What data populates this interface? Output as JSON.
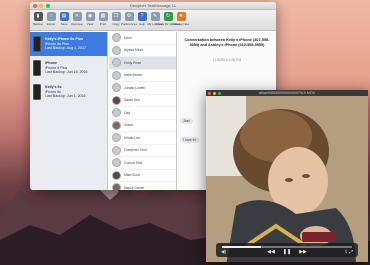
{
  "app": {
    "title": "Decipher TextMessage 11",
    "toolbar": [
      {
        "label": "Backup",
        "icon": "phone-backup-icon",
        "glyph": "▮",
        "tone": "dark"
      },
      {
        "label": "Export",
        "icon": "export-icon",
        "glyph": "↑",
        "tone": ""
      },
      {
        "label": "Save",
        "icon": "save-icon",
        "glyph": "▤",
        "tone": "blue"
      },
      {
        "label": "Remove",
        "icon": "remove-icon",
        "glyph": "✕",
        "tone": ""
      },
      {
        "label": "View",
        "icon": "view-icon",
        "glyph": "◉",
        "tone": ""
      },
      {
        "label": "Print",
        "icon": "print-icon",
        "glyph": "▦",
        "tone": ""
      },
      {
        "label": "Copy",
        "icon": "copy-icon",
        "glyph": "❐",
        "tone": ""
      },
      {
        "label": "Preferences",
        "icon": "preferences-icon",
        "glyph": "⚙",
        "tone": ""
      },
      {
        "label": "Help",
        "icon": "help-icon",
        "glyph": "?",
        "tone": "blue"
      },
      {
        "label": "My License",
        "icon": "license-icon",
        "glyph": "✎",
        "tone": ""
      },
      {
        "label": "Check for Updates",
        "icon": "updates-icon",
        "glyph": "↻",
        "tone": "green"
      },
      {
        "label": "Review Now",
        "icon": "review-icon",
        "glyph": "★",
        "tone": "orange"
      }
    ],
    "devices": [
      {
        "lines": [
          "Kelly's iPhone 8s Plus",
          "iPhone 8s Plus",
          "Last Backup: Aug 1, 2017"
        ],
        "selected": true
      },
      {
        "lines": [
          "iPhone",
          "iPhone 8 Plus",
          "Last Backup: Jun 15, 2016"
        ],
        "selected": false
      },
      {
        "lines": [
          "Kelly's 6s",
          "iPhone 6s",
          "Last Backup: Jun 1, 2016"
        ],
        "selected": false
      }
    ],
    "contacts": [
      {
        "name": "Mom",
        "avatar": ""
      },
      {
        "name": "Alyssa Miner",
        "avatar": ""
      },
      {
        "name": "Emily Rose",
        "avatar": "",
        "selected": true
      },
      {
        "name": "Katie Brown",
        "avatar": ""
      },
      {
        "name": "Jordan Lowell",
        "avatar": ""
      },
      {
        "name": "Sarah Kim",
        "avatar": "b"
      },
      {
        "name": "Dad",
        "avatar": ""
      },
      {
        "name": "Grace",
        "avatar": "p"
      },
      {
        "name": "Kristin Lee",
        "avatar": ""
      },
      {
        "name": "Computer Tech",
        "avatar": "q"
      },
      {
        "name": "Connor Ellis",
        "avatar": ""
      },
      {
        "name": "Mike Scott",
        "avatar": "b"
      },
      {
        "name": "Nancy Daniel",
        "avatar": "p"
      },
      {
        "name": "Julia",
        "avatar": "b"
      },
      {
        "name": "Ryan",
        "avatar": "p"
      }
    ],
    "conversation": {
      "title": "Conversation between Kelly's iPhone (407-555-5050) and Ashley's iPhone (415-555-5555)",
      "timestamp": "11/3/2016 6:26 PM",
      "side_labels": [
        "Just",
        "I love th"
      ]
    }
  },
  "player": {
    "title": "afhan9400000000039097910.MOV",
    "progress": 0.3,
    "time": "0:00",
    "rate": "1x"
  }
}
